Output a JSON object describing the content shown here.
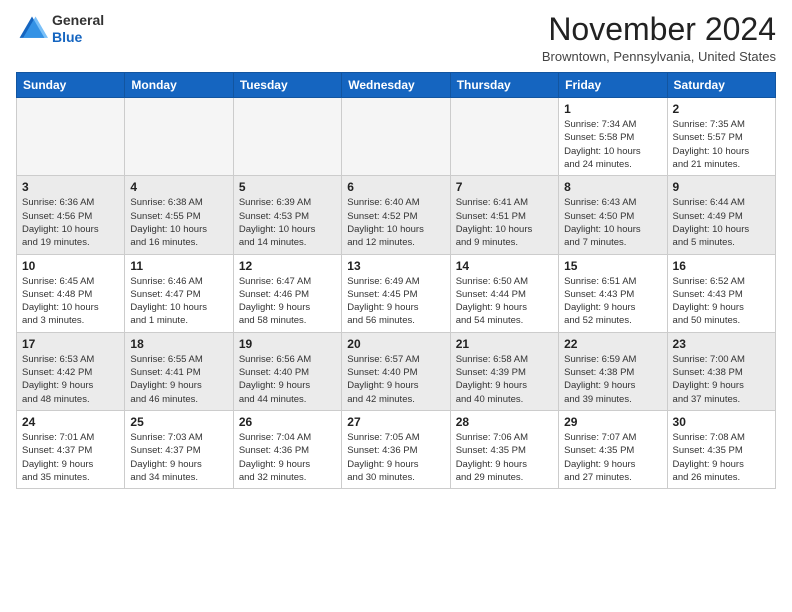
{
  "header": {
    "logo_line1": "General",
    "logo_line2": "Blue",
    "month_title": "November 2024",
    "location": "Browntown, Pennsylvania, United States"
  },
  "days_of_week": [
    "Sunday",
    "Monday",
    "Tuesday",
    "Wednesday",
    "Thursday",
    "Friday",
    "Saturday"
  ],
  "weeks": [
    [
      {
        "day": "",
        "info": ""
      },
      {
        "day": "",
        "info": ""
      },
      {
        "day": "",
        "info": ""
      },
      {
        "day": "",
        "info": ""
      },
      {
        "day": "",
        "info": ""
      },
      {
        "day": "1",
        "info": "Sunrise: 7:34 AM\nSunset: 5:58 PM\nDaylight: 10 hours\nand 24 minutes."
      },
      {
        "day": "2",
        "info": "Sunrise: 7:35 AM\nSunset: 5:57 PM\nDaylight: 10 hours\nand 21 minutes."
      }
    ],
    [
      {
        "day": "3",
        "info": "Sunrise: 6:36 AM\nSunset: 4:56 PM\nDaylight: 10 hours\nand 19 minutes."
      },
      {
        "day": "4",
        "info": "Sunrise: 6:38 AM\nSunset: 4:55 PM\nDaylight: 10 hours\nand 16 minutes."
      },
      {
        "day": "5",
        "info": "Sunrise: 6:39 AM\nSunset: 4:53 PM\nDaylight: 10 hours\nand 14 minutes."
      },
      {
        "day": "6",
        "info": "Sunrise: 6:40 AM\nSunset: 4:52 PM\nDaylight: 10 hours\nand 12 minutes."
      },
      {
        "day": "7",
        "info": "Sunrise: 6:41 AM\nSunset: 4:51 PM\nDaylight: 10 hours\nand 9 minutes."
      },
      {
        "day": "8",
        "info": "Sunrise: 6:43 AM\nSunset: 4:50 PM\nDaylight: 10 hours\nand 7 minutes."
      },
      {
        "day": "9",
        "info": "Sunrise: 6:44 AM\nSunset: 4:49 PM\nDaylight: 10 hours\nand 5 minutes."
      }
    ],
    [
      {
        "day": "10",
        "info": "Sunrise: 6:45 AM\nSunset: 4:48 PM\nDaylight: 10 hours\nand 3 minutes."
      },
      {
        "day": "11",
        "info": "Sunrise: 6:46 AM\nSunset: 4:47 PM\nDaylight: 10 hours\nand 1 minute."
      },
      {
        "day": "12",
        "info": "Sunrise: 6:47 AM\nSunset: 4:46 PM\nDaylight: 9 hours\nand 58 minutes."
      },
      {
        "day": "13",
        "info": "Sunrise: 6:49 AM\nSunset: 4:45 PM\nDaylight: 9 hours\nand 56 minutes."
      },
      {
        "day": "14",
        "info": "Sunrise: 6:50 AM\nSunset: 4:44 PM\nDaylight: 9 hours\nand 54 minutes."
      },
      {
        "day": "15",
        "info": "Sunrise: 6:51 AM\nSunset: 4:43 PM\nDaylight: 9 hours\nand 52 minutes."
      },
      {
        "day": "16",
        "info": "Sunrise: 6:52 AM\nSunset: 4:43 PM\nDaylight: 9 hours\nand 50 minutes."
      }
    ],
    [
      {
        "day": "17",
        "info": "Sunrise: 6:53 AM\nSunset: 4:42 PM\nDaylight: 9 hours\nand 48 minutes."
      },
      {
        "day": "18",
        "info": "Sunrise: 6:55 AM\nSunset: 4:41 PM\nDaylight: 9 hours\nand 46 minutes."
      },
      {
        "day": "19",
        "info": "Sunrise: 6:56 AM\nSunset: 4:40 PM\nDaylight: 9 hours\nand 44 minutes."
      },
      {
        "day": "20",
        "info": "Sunrise: 6:57 AM\nSunset: 4:40 PM\nDaylight: 9 hours\nand 42 minutes."
      },
      {
        "day": "21",
        "info": "Sunrise: 6:58 AM\nSunset: 4:39 PM\nDaylight: 9 hours\nand 40 minutes."
      },
      {
        "day": "22",
        "info": "Sunrise: 6:59 AM\nSunset: 4:38 PM\nDaylight: 9 hours\nand 39 minutes."
      },
      {
        "day": "23",
        "info": "Sunrise: 7:00 AM\nSunset: 4:38 PM\nDaylight: 9 hours\nand 37 minutes."
      }
    ],
    [
      {
        "day": "24",
        "info": "Sunrise: 7:01 AM\nSunset: 4:37 PM\nDaylight: 9 hours\nand 35 minutes."
      },
      {
        "day": "25",
        "info": "Sunrise: 7:03 AM\nSunset: 4:37 PM\nDaylight: 9 hours\nand 34 minutes."
      },
      {
        "day": "26",
        "info": "Sunrise: 7:04 AM\nSunset: 4:36 PM\nDaylight: 9 hours\nand 32 minutes."
      },
      {
        "day": "27",
        "info": "Sunrise: 7:05 AM\nSunset: 4:36 PM\nDaylight: 9 hours\nand 30 minutes."
      },
      {
        "day": "28",
        "info": "Sunrise: 7:06 AM\nSunset: 4:35 PM\nDaylight: 9 hours\nand 29 minutes."
      },
      {
        "day": "29",
        "info": "Sunrise: 7:07 AM\nSunset: 4:35 PM\nDaylight: 9 hours\nand 27 minutes."
      },
      {
        "day": "30",
        "info": "Sunrise: 7:08 AM\nSunset: 4:35 PM\nDaylight: 9 hours\nand 26 minutes."
      }
    ]
  ]
}
